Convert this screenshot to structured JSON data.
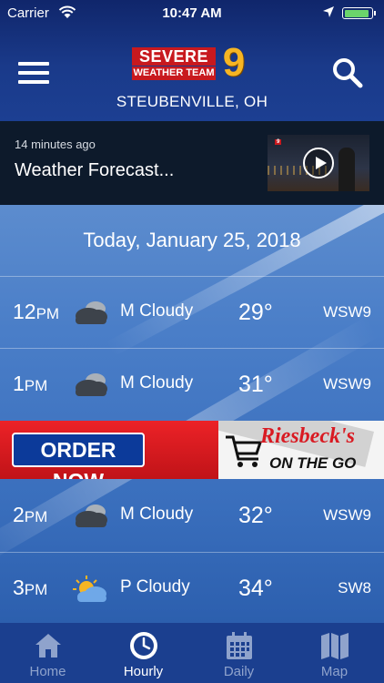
{
  "status_bar": {
    "carrier": "Carrier",
    "time": "10:47 AM"
  },
  "header": {
    "logo": {
      "line1": "SEVERE",
      "line2": "WEATHER TEAM",
      "channel": "9"
    },
    "city": "STEUBENVILLE, OH"
  },
  "video": {
    "time_ago": "14 minutes ago",
    "title": "Weather Forecast..."
  },
  "forecast": {
    "date": "Today, January 25, 2018",
    "rows": [
      {
        "hour": "12",
        "ampm": "PM",
        "icon": "mostly-cloudy-icon",
        "condition": "M Cloudy",
        "temp": "29°",
        "wind": "WSW9"
      },
      {
        "hour": "1",
        "ampm": "PM",
        "icon": "mostly-cloudy-icon",
        "condition": "M Cloudy",
        "temp": "31°",
        "wind": "WSW9"
      },
      {
        "hour": "2",
        "ampm": "PM",
        "icon": "mostly-cloudy-icon",
        "condition": "M Cloudy",
        "temp": "32°",
        "wind": "WSW9"
      },
      {
        "hour": "3",
        "ampm": "PM",
        "icon": "partly-cloudy-icon",
        "condition": "P Cloudy",
        "temp": "34°",
        "wind": "SW8"
      }
    ]
  },
  "ad": {
    "cta": "ORDER NOW",
    "brand": "Riesbeck's",
    "tagline": "ON THE GO"
  },
  "tabbar": {
    "tabs": [
      {
        "label": "Home",
        "icon": "home-icon"
      },
      {
        "label": "Hourly",
        "icon": "clock-icon",
        "active": true
      },
      {
        "label": "Daily",
        "icon": "calendar-icon"
      },
      {
        "label": "Map",
        "icon": "map-icon"
      }
    ]
  },
  "colors": {
    "header": "#1a3a8a",
    "tabbar": "#1b3f8f",
    "logo_red": "#c8191e",
    "logo_gold": "#f6b523",
    "battery": "#6bd46b"
  }
}
